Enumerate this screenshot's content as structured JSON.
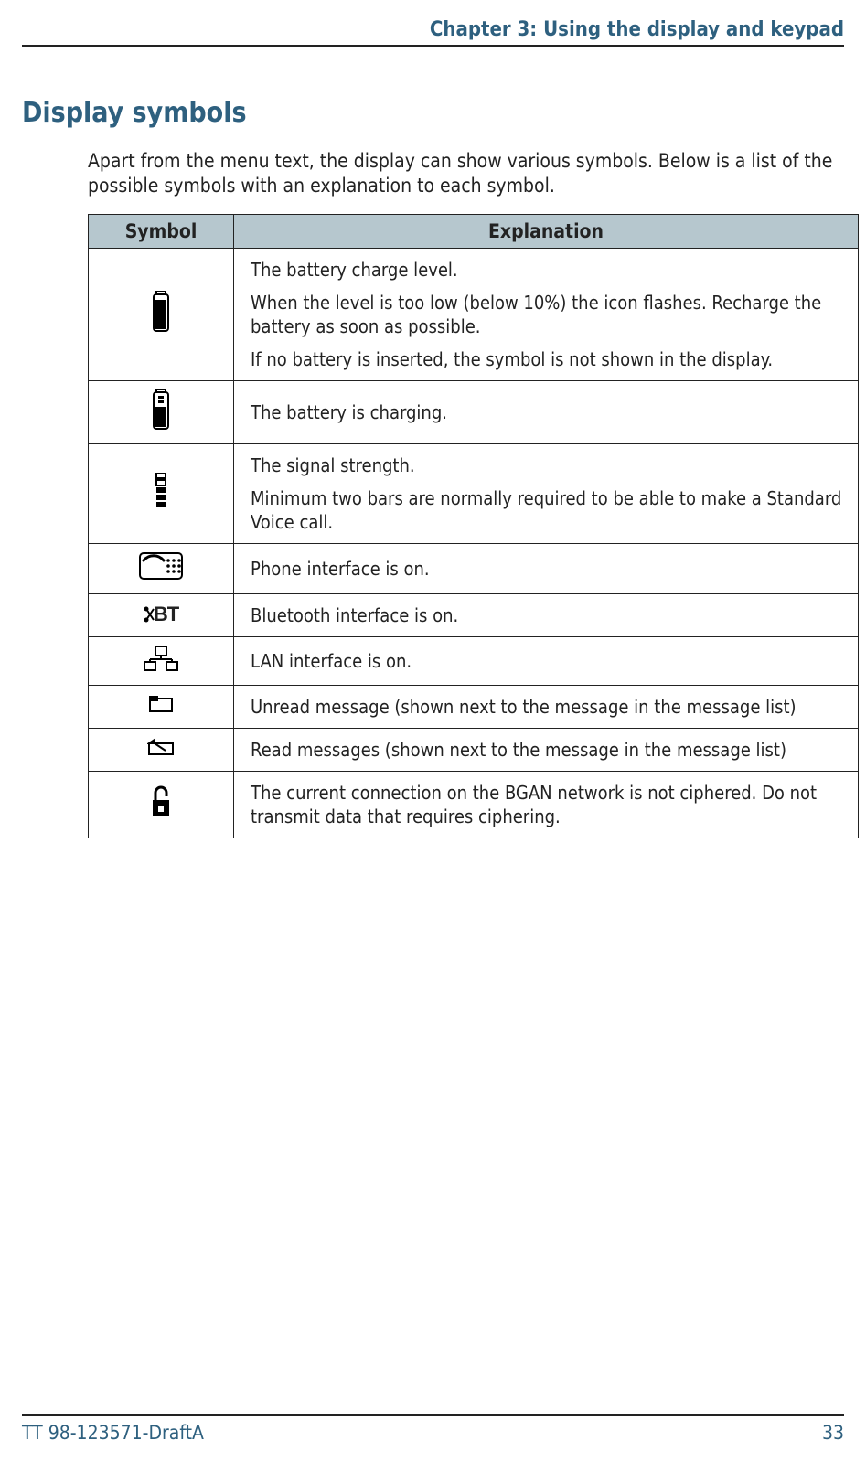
{
  "header": {
    "chapter": "Chapter 3: Using the display and keypad"
  },
  "section_title": "Display symbols",
  "intro": "Apart from the menu text, the display can show various symbols. Below is a list of the possible symbols with an explanation to each symbol.",
  "table": {
    "headers": {
      "symbol": "Symbol",
      "explanation": "Explanation"
    },
    "rows": [
      {
        "icon": "battery-icon",
        "explanation_lines": [
          "The battery charge level.",
          "When the level is too low (below 10%) the icon flashes. Recharge the battery as soon as possible.",
          "If no battery is inserted, the symbol is not shown in the display."
        ]
      },
      {
        "icon": "battery-charging-icon",
        "explanation_lines": [
          "The battery is charging."
        ]
      },
      {
        "icon": "signal-strength-icon",
        "explanation_lines": [
          "The signal strength.",
          "Minimum two bars are normally required to be able to make a Standard Voice call."
        ]
      },
      {
        "icon": "phone-interface-icon",
        "explanation_lines": [
          "Phone interface is on."
        ]
      },
      {
        "icon": "bluetooth-icon",
        "icon_text": "BT",
        "explanation_lines": [
          "Bluetooth interface is on."
        ]
      },
      {
        "icon": "lan-icon",
        "explanation_lines": [
          "LAN interface is on."
        ]
      },
      {
        "icon": "unread-message-icon",
        "explanation_lines": [
          "Unread message (shown next to the message in the message list)"
        ]
      },
      {
        "icon": "read-message-icon",
        "explanation_lines": [
          "Read messages (shown next to the message in the message list)"
        ]
      },
      {
        "icon": "not-ciphered-icon",
        "explanation_lines": [
          "The current connection on the BGAN network is not ciphered. Do not transmit data that requires ciphering."
        ]
      }
    ]
  },
  "footer": {
    "doc_id": "TT 98-123571-DraftA",
    "page": "33"
  }
}
